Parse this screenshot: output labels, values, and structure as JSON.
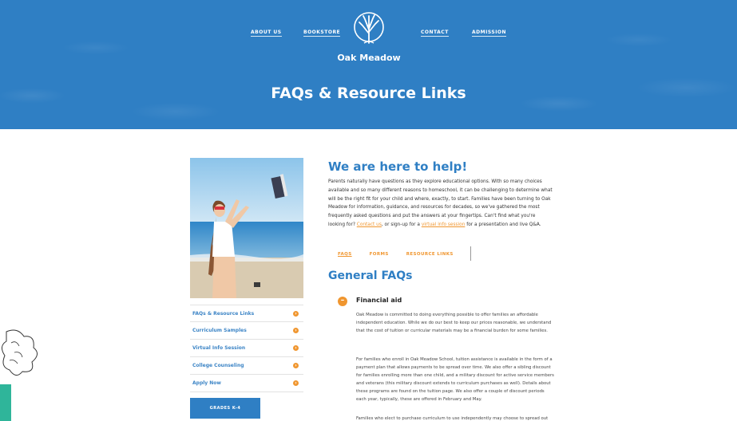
{
  "nav": {
    "about": "ABOUT US",
    "bookstore": "BOOKSTORE",
    "contact": "CONTACT",
    "admission": "ADMISSION"
  },
  "logo": {
    "name": "Oak Meadow"
  },
  "hero": {
    "title": "FAQs & Resource Links"
  },
  "sidebar": {
    "items": [
      {
        "label": "FAQs & Resource Links"
      },
      {
        "label": "Curriculum Samples"
      },
      {
        "label": "Virtual Info Session"
      },
      {
        "label": "College Counseling"
      },
      {
        "label": "Apply Now"
      }
    ],
    "grades_button": "GRADES K-4"
  },
  "main": {
    "heading": "We are here to help!",
    "intro_part1": "Parents naturally have questions as they explore educational options. With so many choices available and so many different reasons to homeschool, it can be challenging to determine what will be the right fit for your child and where, exactly, to start. Families have been turning to Oak Meadow for information, guidance, and resources for decades, so we've gathered the most frequently asked questions and put the answers at your fingertips. Can't find what you're looking for? ",
    "intro_link1": "Contact us",
    "intro_part2": ", or sign-up for a ",
    "intro_link2": "virtual info session",
    "intro_part3": " for a presentation and live Q&A.",
    "tabs": [
      {
        "label": "FAQS"
      },
      {
        "label": "FORMS"
      },
      {
        "label": "RESOURCE LINKS"
      }
    ],
    "general_heading": "General FAQs",
    "faq": {
      "toggle": "–",
      "title": "Financial aid",
      "p1": "Oak Meadow is committed to doing everything possible to offer families an affordable independent education. While we do our best to keep our prices reasonable, we understand that the cost of tuition or curricular materials may be a financial burden for some families.",
      "p2": "For families who enroll in Oak Meadow School, tuition assistance is available in the form of a payment plan that allows payments to be spread over time. We also offer a sibling discount for families enrolling more than one child, and a military discount for active service members and veterans (this military discount extends to curriculum purchases as well). Details about these programs are found on the tuition page. We also offer a couple of discount periods each year, typically, these are offered in February and May.",
      "p3": "Families who elect to purchase curriculum to use independently may choose to spread out"
    }
  },
  "colors": {
    "brand_blue": "#2f7fc4",
    "accent_orange": "#f0962f"
  }
}
